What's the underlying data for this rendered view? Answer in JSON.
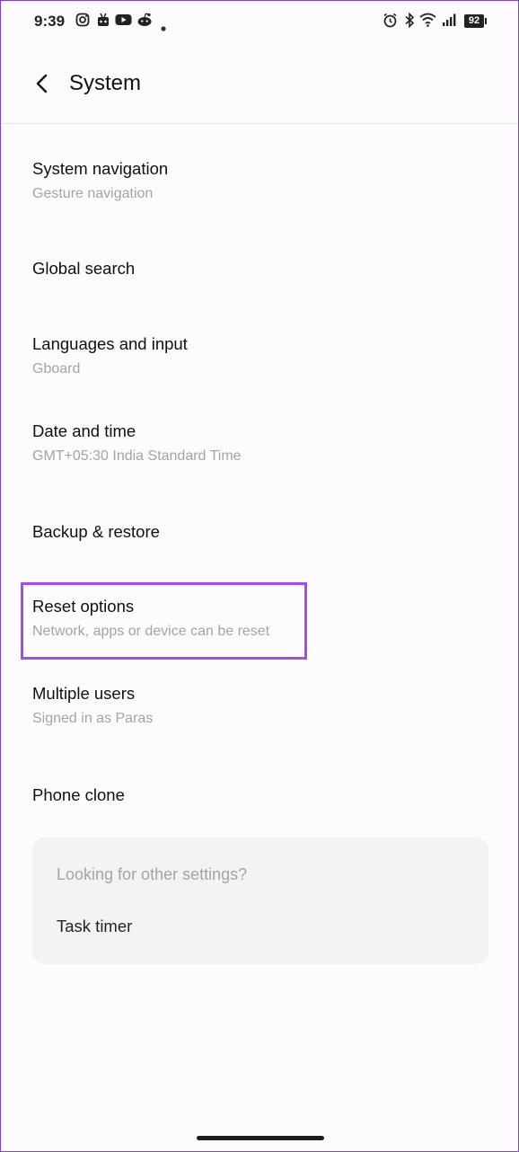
{
  "status_bar": {
    "time": "9:39",
    "battery": "92",
    "left_icons": [
      "instagram-icon",
      "notification-app-icon",
      "youtube-icon",
      "reddit-icon",
      "dot-icon"
    ],
    "right_icons": [
      "alarm-icon",
      "bluetooth-icon",
      "wifi-icon",
      "signal-icon",
      "battery-icon"
    ]
  },
  "header": {
    "title": "System",
    "back_icon": "back-arrow-icon"
  },
  "items": [
    {
      "title": "System navigation",
      "subtitle": "Gesture navigation"
    },
    {
      "title": "Global search"
    },
    {
      "title": "Languages and input",
      "subtitle": "Gboard"
    },
    {
      "title": "Date and time",
      "subtitle": "GMT+05:30 India Standard Time"
    },
    {
      "title": "Backup & restore"
    },
    {
      "title": "Reset options",
      "subtitle": "Network, apps or device can be reset"
    },
    {
      "title": "Multiple users",
      "subtitle": "Signed in as Paras"
    },
    {
      "title": "Phone clone"
    }
  ],
  "other_settings": {
    "title": "Looking for other settings?",
    "link": "Task timer"
  },
  "colors": {
    "highlight": "#a64be8",
    "subtitle": "#a5a3a6",
    "background": "#fdfbfd"
  }
}
